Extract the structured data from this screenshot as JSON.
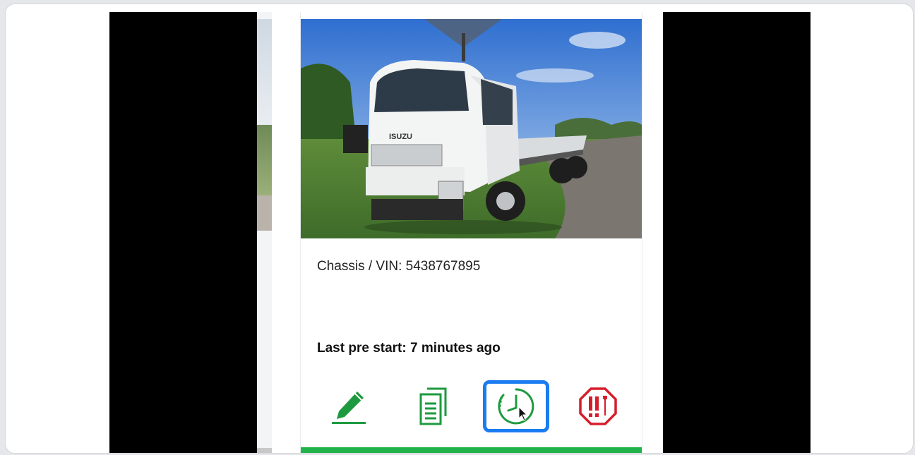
{
  "vehicle": {
    "vin_label": "Chassis / VIN: 5438767895",
    "last_prestart": "Last pre start: 7 minutes ago",
    "brand_on_cab": "ISUZU"
  },
  "actions": [
    {
      "name": "edit",
      "icon": "pencil-icon"
    },
    {
      "name": "documents",
      "icon": "documents-icon"
    },
    {
      "name": "history",
      "icon": "clock-icon",
      "active": true
    },
    {
      "name": "report-defect",
      "icon": "warning-wrench-icon"
    }
  ],
  "colors": {
    "accent_green": "#21b24b",
    "icon_green": "#1d9a3f",
    "alert_red": "#d61e2b",
    "selection_blue": "#1a7cf0"
  }
}
